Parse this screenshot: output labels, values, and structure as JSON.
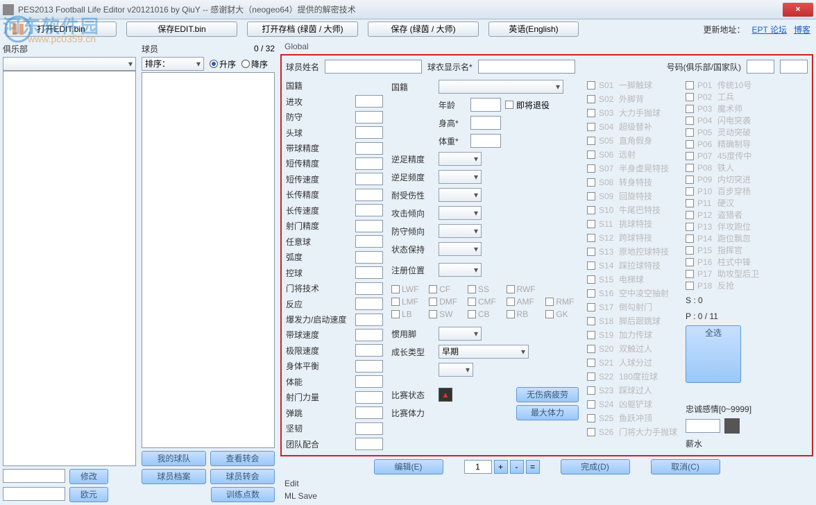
{
  "title": "PES2013 Football Life Editor v20121016 by QiuY          -- 感谢豺大（neogeo64）提供的解密技术",
  "watermark": "河东软件园",
  "watermark_url": "www.pc0359.cn",
  "toolbar": {
    "open_edit": "打开EDIT.bin",
    "save_edit": "保存EDIT.bin",
    "open_save": "打开存档 (绿茵 / 大师)",
    "save_save": "保存 (绿茵 / 大师)",
    "lang": "英语(English)",
    "update_addr": "更新地址：",
    "link_forum": "EPT 论坛",
    "link_blog": "博客"
  },
  "left": {
    "header": "俱乐部"
  },
  "mid": {
    "header": "球员",
    "count": "0 / 32",
    "sort": "排序：",
    "asc": "升序",
    "desc": "降序"
  },
  "left_buttons": {
    "modify": "修改",
    "my_team": "我的球队",
    "view_transfer": "查看转会",
    "euro": "欧元",
    "player_file": "球员档案",
    "player_transfer": "球员转会",
    "train_points": "训练点数"
  },
  "global_tab": "Global",
  "topfields": {
    "name": "球员姓名",
    "shirt": "球衣显示名*",
    "number": "号码(俱乐部/国家队)"
  },
  "attrs": [
    "国籍",
    "进攻",
    "防守",
    "头球",
    "带球精度",
    "短传精度",
    "短传速度",
    "长传精度",
    "长传速度",
    "射门精度",
    "任意球",
    "弧度",
    "控球",
    "门将技术",
    "反应",
    "爆发力/启动速度",
    "带球速度",
    "极限速度",
    "身体平衡",
    "体能",
    "射门力量",
    "弹跳",
    "坚韧",
    "团队配合"
  ],
  "mid_fields": {
    "nationality": "国籍",
    "age": "年龄",
    "retire": "即将退役",
    "height": "身高*",
    "weight": "体重*",
    "weak_acc": "逆足精度",
    "weak_freq": "逆足频度",
    "injury": "耐受伤性",
    "atk_tend": "攻击倾向",
    "def_tend": "防守倾向",
    "form": "状态保持",
    "reg_pos": "注册位置",
    "foot": "惯用脚",
    "growth": "成长类型",
    "growth_val": "早期",
    "match_cond": "比赛状态",
    "no_injury": "无伤病疲劳",
    "match_stam": "比赛体力",
    "max_stam": "最大体力",
    "loyalty": "忠诚感情[0~9999]",
    "salary": "薪水"
  },
  "positions": [
    "LWF",
    "CF",
    "SS",
    "RWF",
    "",
    "LMF",
    "DMF",
    "CMF",
    "AMF",
    "RMF",
    "LB",
    "SW",
    "CB",
    "RB",
    "GK"
  ],
  "skills": [
    {
      "c": "S01",
      "n": "一脚触球"
    },
    {
      "c": "S02",
      "n": "外脚背"
    },
    {
      "c": "S03",
      "n": "大力手抛球"
    },
    {
      "c": "S04",
      "n": "超级替补"
    },
    {
      "c": "S05",
      "n": "直角假身"
    },
    {
      "c": "S06",
      "n": "远射"
    },
    {
      "c": "S07",
      "n": "半身虚晃特技"
    },
    {
      "c": "S08",
      "n": "转身特技"
    },
    {
      "c": "S09",
      "n": "回旋特技"
    },
    {
      "c": "S10",
      "n": "牛尾巴特技"
    },
    {
      "c": "S11",
      "n": "挑球特技"
    },
    {
      "c": "S12",
      "n": "跨球特技"
    },
    {
      "c": "S13",
      "n": "原地控球特技"
    },
    {
      "c": "S14",
      "n": "踩拉球特技"
    },
    {
      "c": "S15",
      "n": "电梯球"
    },
    {
      "c": "S16",
      "n": "空中凌空抽射"
    },
    {
      "c": "S17",
      "n": "倒勾射门"
    },
    {
      "c": "S18",
      "n": "脚后跟跳球"
    },
    {
      "c": "S19",
      "n": "加力传球"
    },
    {
      "c": "S20",
      "n": "双触过人"
    },
    {
      "c": "S21",
      "n": "人球分过"
    },
    {
      "c": "S22",
      "n": "180度拉球"
    },
    {
      "c": "S23",
      "n": "踩球过人"
    },
    {
      "c": "S24",
      "n": "凶躯铲球"
    },
    {
      "c": "S25",
      "n": "鱼跃冲顶"
    },
    {
      "c": "S26",
      "n": "门将大力手抛球"
    }
  ],
  "pstyles": [
    {
      "c": "P01",
      "n": "传统10号"
    },
    {
      "c": "P02",
      "n": "工兵"
    },
    {
      "c": "P03",
      "n": "魔术师"
    },
    {
      "c": "P04",
      "n": "闪电突袭"
    },
    {
      "c": "P05",
      "n": "灵动突破"
    },
    {
      "c": "P06",
      "n": "精确制导"
    },
    {
      "c": "P07",
      "n": "45度传中"
    },
    {
      "c": "P08",
      "n": "铁人"
    },
    {
      "c": "P09",
      "n": "内切突进"
    },
    {
      "c": "P10",
      "n": "百步穿杨"
    },
    {
      "c": "P11",
      "n": "硬汉"
    },
    {
      "c": "P12",
      "n": "盗猎者"
    },
    {
      "c": "P13",
      "n": "伴攻跑位"
    },
    {
      "c": "P14",
      "n": "跑位飘忽"
    },
    {
      "c": "P15",
      "n": "指挥官"
    },
    {
      "c": "P16",
      "n": "柱式中锋"
    },
    {
      "c": "P17",
      "n": "助攻型后卫"
    },
    {
      "c": "P18",
      "n": "反抢"
    }
  ],
  "sum_s": "S : 0",
  "sum_p": "P : 0 / 11",
  "select_all": "全选",
  "bottom": {
    "edit": "编辑(E)",
    "page": "1",
    "done": "完成(D)",
    "cancel": "取消(C)"
  },
  "status1": "Edit",
  "status2": "ML Save"
}
